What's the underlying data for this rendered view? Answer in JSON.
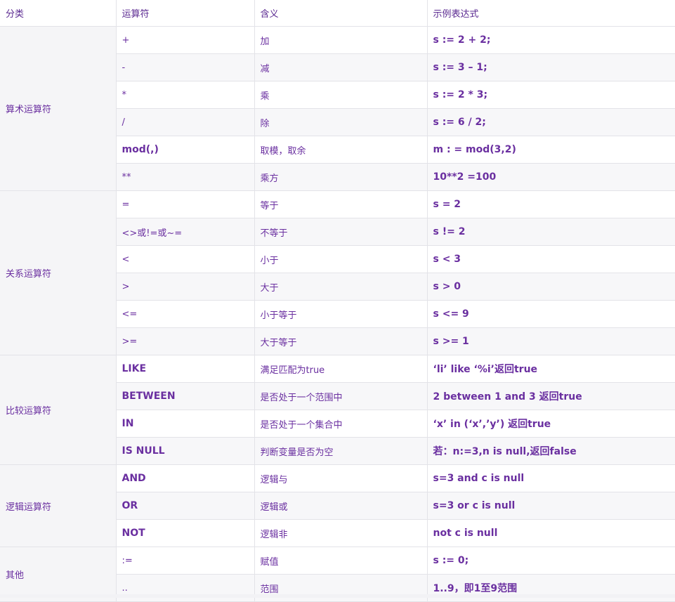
{
  "header": {
    "col_category": "分类",
    "col_operator": "运算符",
    "col_meaning": "含义",
    "col_example": "示例表达式"
  },
  "groups": [
    {
      "category": "算术运算符",
      "rows": [
        {
          "operator": "+",
          "meaning": "加",
          "example": "s := 2 + 2;"
        },
        {
          "operator": "-",
          "meaning": "减",
          "example": "s := 3 – 1;"
        },
        {
          "operator": "*",
          "meaning": "乘",
          "example": "s := 2 * 3;"
        },
        {
          "operator": "/",
          "meaning": "除",
          "example": "s := 6 / 2;"
        },
        {
          "operator": "mod(,)",
          "meaning": "取模，取余",
          "example": "m : = mod(3,2)"
        },
        {
          "operator": "**",
          "meaning": "乘方",
          "example": "10**2 =100"
        }
      ]
    },
    {
      "category": "关系运算符",
      "rows": [
        {
          "operator": "=",
          "meaning": "等于",
          "example": "s = 2"
        },
        {
          "operator": "<>或!=或~=",
          "meaning": "不等于",
          "example": "s != 2"
        },
        {
          "operator": "<",
          "meaning": "小于",
          "example": "s < 3"
        },
        {
          "operator": ">",
          "meaning": "大于",
          "example": "s > 0"
        },
        {
          "operator": "<=",
          "meaning": "小于等于",
          "example": "s <= 9"
        },
        {
          "operator": ">=",
          "meaning": "大于等于",
          "example": "s >= 1"
        }
      ]
    },
    {
      "category": "比较运算符",
      "rows": [
        {
          "operator": "LIKE",
          "meaning": "满足匹配为true",
          "example": "‘li’ like ‘%i’返回true"
        },
        {
          "operator": "BETWEEN",
          "meaning": "是否处于一个范围中",
          "example": "2 between 1 and 3 返回true"
        },
        {
          "operator": "IN",
          "meaning": "是否处于一个集合中",
          "example": "‘x’ in (‘x’,’y’) 返回true"
        },
        {
          "operator": "IS NULL",
          "meaning": "判断变量是否为空",
          "example": "若：n:=3,n is null,返回false"
        }
      ]
    },
    {
      "category": "逻辑运算符",
      "rows": [
        {
          "operator": "AND",
          "meaning": "逻辑与",
          "example": "s=3 and c is null"
        },
        {
          "operator": "OR",
          "meaning": "逻辑或",
          "example": "s=3 or c is null"
        },
        {
          "operator": "NOT",
          "meaning": "逻辑非",
          "example": "not c is null"
        }
      ]
    },
    {
      "category": "其他",
      "rows": [
        {
          "operator": ":=",
          "meaning": "赋值",
          "example": "s := 0;"
        },
        {
          "operator": "..",
          "meaning": "范围",
          "example": "1..9，即1至9范围"
        }
      ]
    }
  ]
}
